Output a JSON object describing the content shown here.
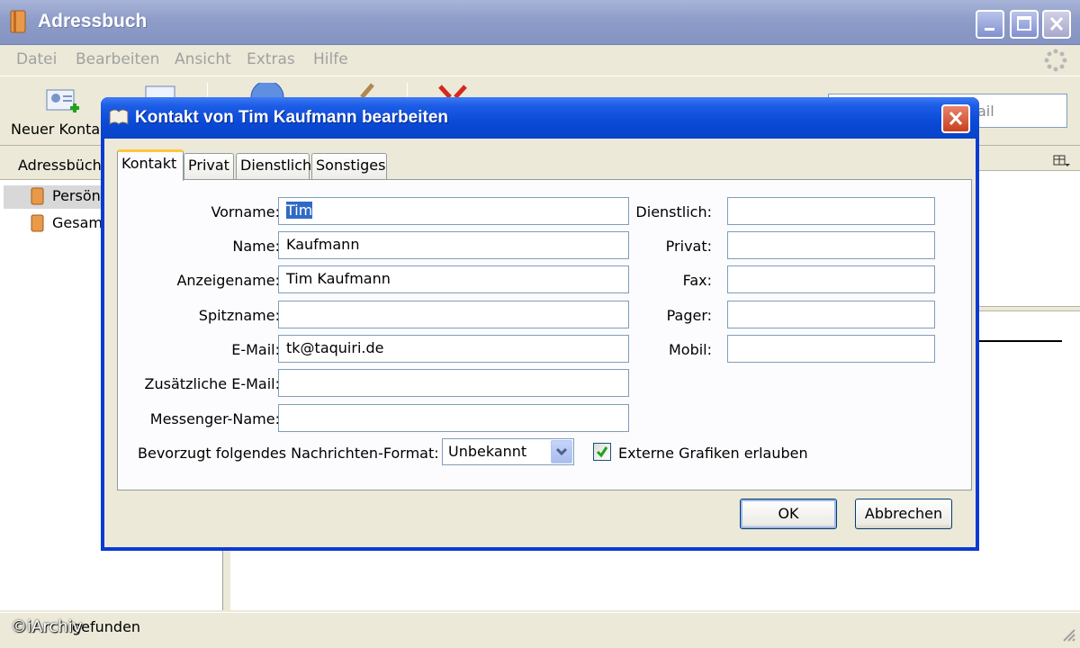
{
  "window": {
    "title": "Adressbuch"
  },
  "menubar": {
    "items": [
      "Datei",
      "Bearbeiten",
      "Ansicht",
      "Extras",
      "Hilfe"
    ]
  },
  "toolbar": {
    "new_contact_label": "Neuer Kontakt",
    "search_placeholder": "ail"
  },
  "sidebar": {
    "header": "Adressbüch",
    "items": [
      "Persön",
      "Gesamm"
    ]
  },
  "statusbar": {
    "text": "gefunden",
    "watermark": "©iArchiv"
  },
  "dialog": {
    "title": "Kontakt von Tim Kaufmann bearbeiten",
    "tabs": [
      "Kontakt",
      "Privat",
      "Dienstlich",
      "Sonstiges"
    ],
    "active_tab": "Kontakt",
    "fields_left": [
      {
        "label": "Vorname:",
        "value": "Tim"
      },
      {
        "label": "Name:",
        "value": "Kaufmann"
      },
      {
        "label": "Anzeigename:",
        "value": "Tim Kaufmann"
      },
      {
        "label": "Spitzname:",
        "value": ""
      },
      {
        "label": "E-Mail:",
        "value": "tk@taquiri.de"
      },
      {
        "label": "Zusätzliche E-Mail:",
        "value": ""
      },
      {
        "label": "Messenger-Name:",
        "value": ""
      }
    ],
    "fields_right": [
      {
        "label": "Dienstlich:",
        "value": ""
      },
      {
        "label": "Privat:",
        "value": ""
      },
      {
        "label": "Fax:",
        "value": ""
      },
      {
        "label": "Pager:",
        "value": ""
      },
      {
        "label": "Mobil:",
        "value": ""
      }
    ],
    "format_label": "Bevorzugt folgendes Nachrichten-Format:",
    "format_value": "Unbekannt",
    "external_images_label": "Externe Grafiken erlauben",
    "external_images_checked": true,
    "ok_label": "OK",
    "cancel_label": "Abbrechen"
  },
  "colors": {
    "dialog_titlebar": "#0a4ad6",
    "selection": "#316ac5",
    "checkmark": "#21a121"
  }
}
